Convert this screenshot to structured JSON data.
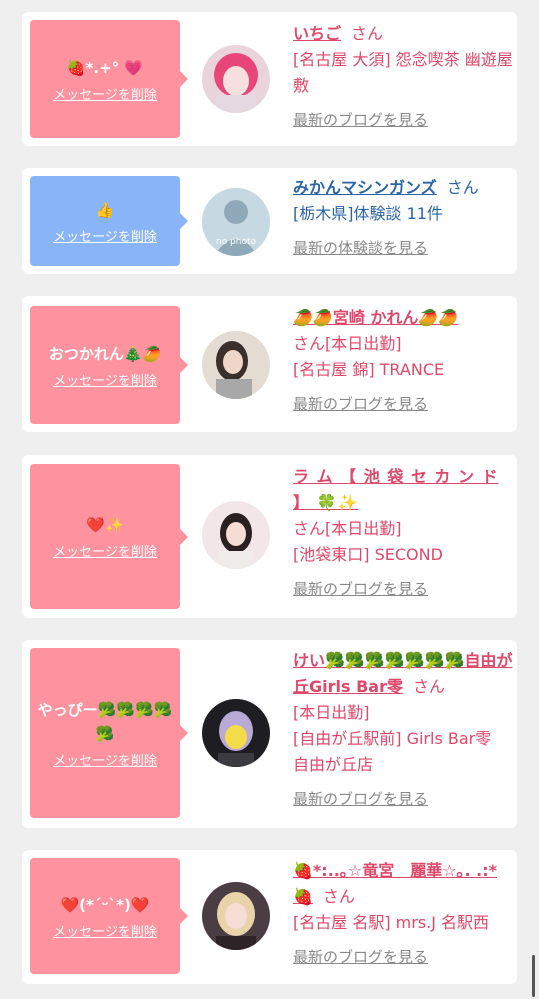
{
  "cards": [
    {
      "message": "🍓*.+° 💗",
      "delete_label": "メッセージを削除",
      "name": "いちご",
      "san": "さん",
      "details": [
        "[名古屋 大須] 怨念喫茶 幽遊屋敷"
      ],
      "link": "最新のブログを見る"
    },
    {
      "message": "👍",
      "delete_label": "メッセージを削除",
      "name": "みかんマシンガンズ",
      "san": "さん",
      "details": [
        "[栃木県]体験談 11件"
      ],
      "link": "最新の体験談を見る",
      "avatar_text": "no photo"
    },
    {
      "message": "おつかれん🎄🥭",
      "delete_label": "メッセージを削除",
      "name": "🥭🥭宮崎 かれん🥭🥭",
      "san": "さん",
      "details": [
        "[本日出勤]",
        "[名古屋 錦] TRANCE"
      ],
      "link": "最新のブログを見る"
    },
    {
      "message": "❤️✨",
      "delete_label": "メッセージを削除",
      "name": "ラ ム 【 池 袋 セ カ ン ド 】 🍀✨",
      "san": "さん",
      "details": [
        "[本日出勤]",
        "[池袋東口] SECOND"
      ],
      "link": "最新のブログを見る"
    },
    {
      "message": "やっぴー🥦🥦🥦🥦🥦",
      "delete_label": "メッセージを削除",
      "name": "けい🥦🥦🥦🥦🥦🥦🥦自由が丘Girls Bar零",
      "san": "さん",
      "details": [
        "[本日出勤]",
        "[自由が丘駅前] Girls Bar零　自由が丘店"
      ],
      "link": "最新のブログを見る"
    },
    {
      "message": "❤️(*´ᵕ`*)❤️",
      "delete_label": "メッセージを削除",
      "name": "🍓*:..｡☆竜宮　麗華☆｡. .:*🍓",
      "san": "さん",
      "details": [
        "[名古屋 名駅] mrs.J 名駅西"
      ],
      "link": "最新のブログを見る"
    }
  ]
}
